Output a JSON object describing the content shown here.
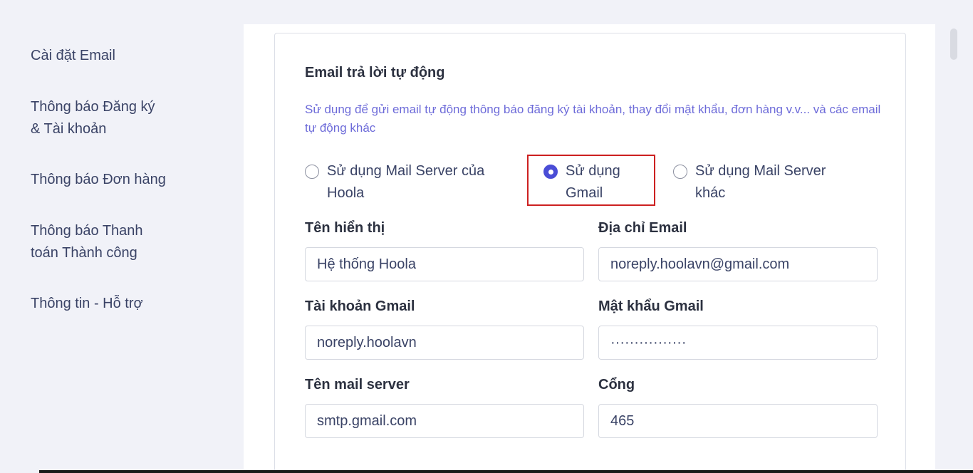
{
  "sidebar": {
    "items": [
      {
        "label": "Cài đặt Email"
      },
      {
        "label_line1": "Thông báo Đăng ký",
        "label_line2": "& Tài khoản"
      },
      {
        "label": "Thông báo Đơn hàng"
      },
      {
        "label_line1": "Thông báo Thanh",
        "label_line2": "toán Thành công"
      },
      {
        "label": "Thông tin - Hỗ trợ"
      }
    ]
  },
  "section": {
    "title": "Email trả lời tự động",
    "description": "Sử dụng để gửi email tự động thông báo đăng ký tài khoản, thay đổi mật khẩu, đơn hàng v.v... và các email tự động khác"
  },
  "radio_options": [
    {
      "line1": "Sử dụng Mail Server của",
      "line2": "Hoola",
      "checked": false
    },
    {
      "line1": "Sử dụng",
      "line2": "Gmail",
      "checked": true
    },
    {
      "line1": "Sử dụng Mail Server",
      "line2": "khác",
      "checked": false
    }
  ],
  "form": {
    "display_name_label": "Tên hiển thị",
    "display_name_value": "Hệ thống Hoola",
    "email_address_label": "Địa chỉ Email",
    "email_address_value": "noreply.hoolavn@gmail.com",
    "gmail_account_label": "Tài khoản Gmail",
    "gmail_account_value": "noreply.hoolavn",
    "gmail_password_label": "Mật khẩu Gmail",
    "gmail_password_value": "················",
    "mail_server_label": "Tên mail server",
    "mail_server_value": "smtp.gmail.com",
    "port_label": "Cổng",
    "port_value": "465"
  },
  "colors": {
    "accent": "#4a4dd6",
    "description_text": "#6d6bd9",
    "highlight_border": "#cc2020",
    "background": "#f1f2f8"
  }
}
